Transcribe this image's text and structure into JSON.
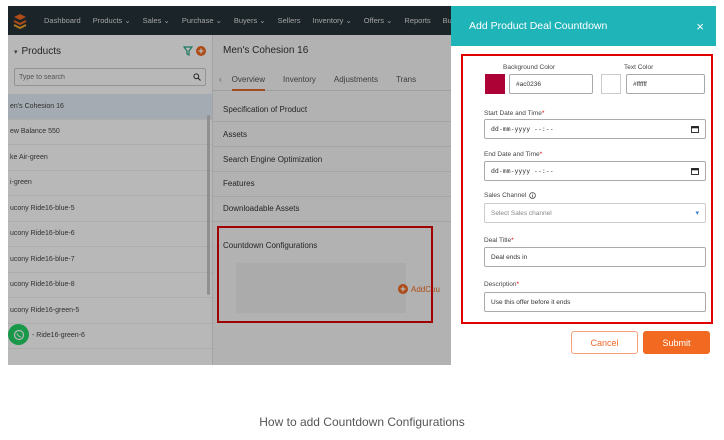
{
  "nav": {
    "items": [
      "Dashboard",
      "Products ⌄",
      "Sales ⌄",
      "Purchase ⌄",
      "Buyers ⌄",
      "Sellers",
      "Inventory ⌄",
      "Offers ⌄",
      "Reports",
      "Bu"
    ]
  },
  "products_panel": {
    "title": "Products",
    "search_placeholder": "Type to search",
    "items": [
      "en's Cohesion 16",
      "ew Balance 550",
      "ke Air-green",
      "i-green",
      "ucony Ride16-blue-5",
      "ucony Ride16-blue-6",
      "ucony Ride16-blue-7",
      "ucony Ride16-blue-8",
      "ucony Ride16-green-5",
      "- Ride16-green-6"
    ]
  },
  "product": {
    "title": "Men's Cohesion 16",
    "tabs": [
      "Overview",
      "Inventory",
      "Adjustments",
      "Trans"
    ],
    "sections": [
      "Specification of Product",
      "Assets",
      "Search Engine Optimization",
      "Features",
      "Downloadable Assets"
    ],
    "countdown_section": "Countdown Configurations",
    "add_countdown_label": "AddCou"
  },
  "drawer": {
    "title": "Add Product Deal Countdown",
    "close_symbol": "×",
    "background_color_label": "Background Color",
    "background_color_value": "#ac0236",
    "text_color_label": "Text Color",
    "text_color_value": "#ffffff",
    "start_label": "Start Date and Time",
    "end_label": "End Date and Time",
    "datetime_placeholder": "dd-mm-yyyy  --:--",
    "sales_channel_label": "Sales Channel",
    "sales_channel_placeholder": "Select Sales channel",
    "deal_title_label": "Deal Title",
    "deal_title_value": "Deal ends in",
    "description_label": "Description",
    "description_value": "Use this offer before it ends",
    "required_mark": "*",
    "cancel_label": "Cancel",
    "submit_label": "Submit"
  },
  "caption": "How to add Countdown Configurations",
  "colors": {
    "nav_bg": "#263238",
    "drawer_header": "#1fb4b8",
    "accent_orange": "#f26a21",
    "highlight_red": "#e00000",
    "swatch_bg": "#ac0236",
    "swatch_text": "#ffffff"
  }
}
